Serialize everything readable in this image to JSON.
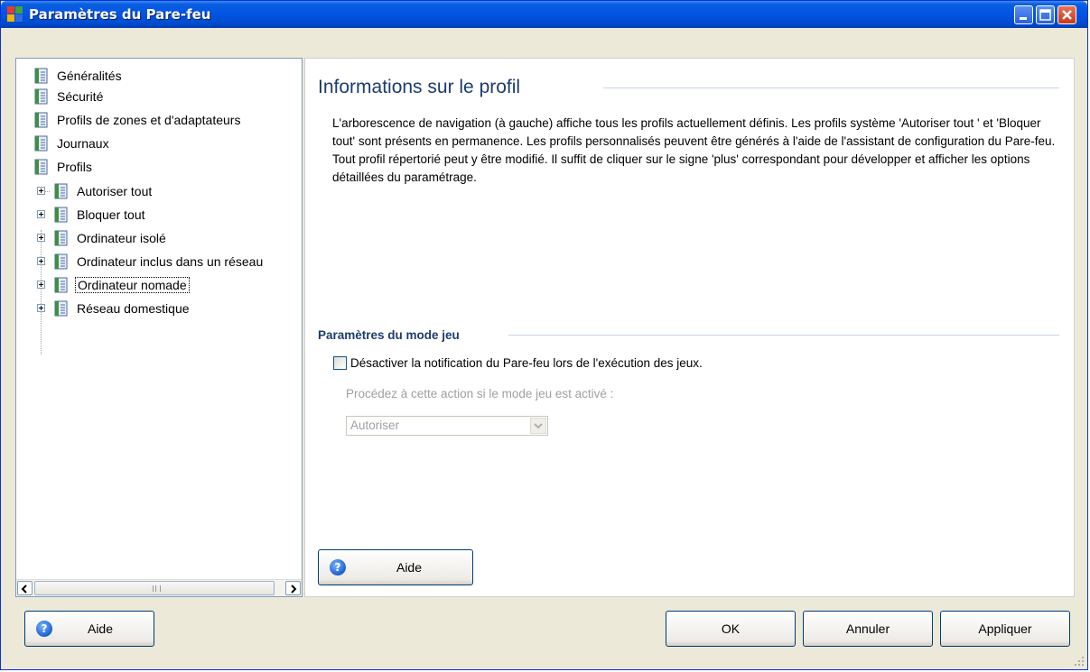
{
  "window": {
    "title": "Paramètres du Pare-feu",
    "icon": "avg-app-icon",
    "controls": [
      "minimize-icon",
      "maximize-icon",
      "close-icon"
    ]
  },
  "tree": {
    "items": [
      {
        "label": "Généralités",
        "level": 0
      },
      {
        "label": "Sécurité",
        "level": 0
      },
      {
        "label": "Profils de zones et d'adaptateurs",
        "level": 0
      },
      {
        "label": "Journaux",
        "level": 0
      },
      {
        "label": "Profils",
        "level": 0
      },
      {
        "label": "Autoriser tout",
        "level": 1
      },
      {
        "label": "Bloquer tout",
        "level": 1
      },
      {
        "label": "Ordinateur isolé",
        "level": 1
      },
      {
        "label": "Ordinateur inclus dans un réseau",
        "level": 1
      },
      {
        "label": "Ordinateur nomade",
        "level": 1,
        "selected": true
      },
      {
        "label": "Réseau domestique",
        "level": 1
      }
    ],
    "scrollbar_grip": "III"
  },
  "content": {
    "title": "Informations sur le profil",
    "description": "L'arborescence de navigation (à gauche) affiche tous les profils actuellement définis. Les profils système 'Autoriser tout ' et 'Bloquer tout' sont présents en permanence. Les profils personnalisés peuvent être générés à l'aide de l'assistant de configuration du Pare-feu. Tout profil répertorié peut y être modifié. Il suffit de cliquer sur le signe 'plus' correspondant pour développer et afficher les options détaillées du paramétrage.",
    "game_mode_title": "Paramètres du mode jeu",
    "game_mode_checkbox_label": "Désactiver la notification du Pare-feu lors de l'exécution des jeux.",
    "game_mode_checkbox_checked": false,
    "action_label": "Procédez à cette action si le mode jeu est activé :",
    "action_select_value": "Autoriser",
    "help_button": "Aide"
  },
  "footer": {
    "help_button": "Aide",
    "ok_button": "OK",
    "cancel_button": "Annuler",
    "apply_button": "Appliquer"
  },
  "colors": {
    "titlebar": "#0054e3",
    "section_title": "#1c3c6e",
    "disabled_text": "#a0a0a0"
  }
}
